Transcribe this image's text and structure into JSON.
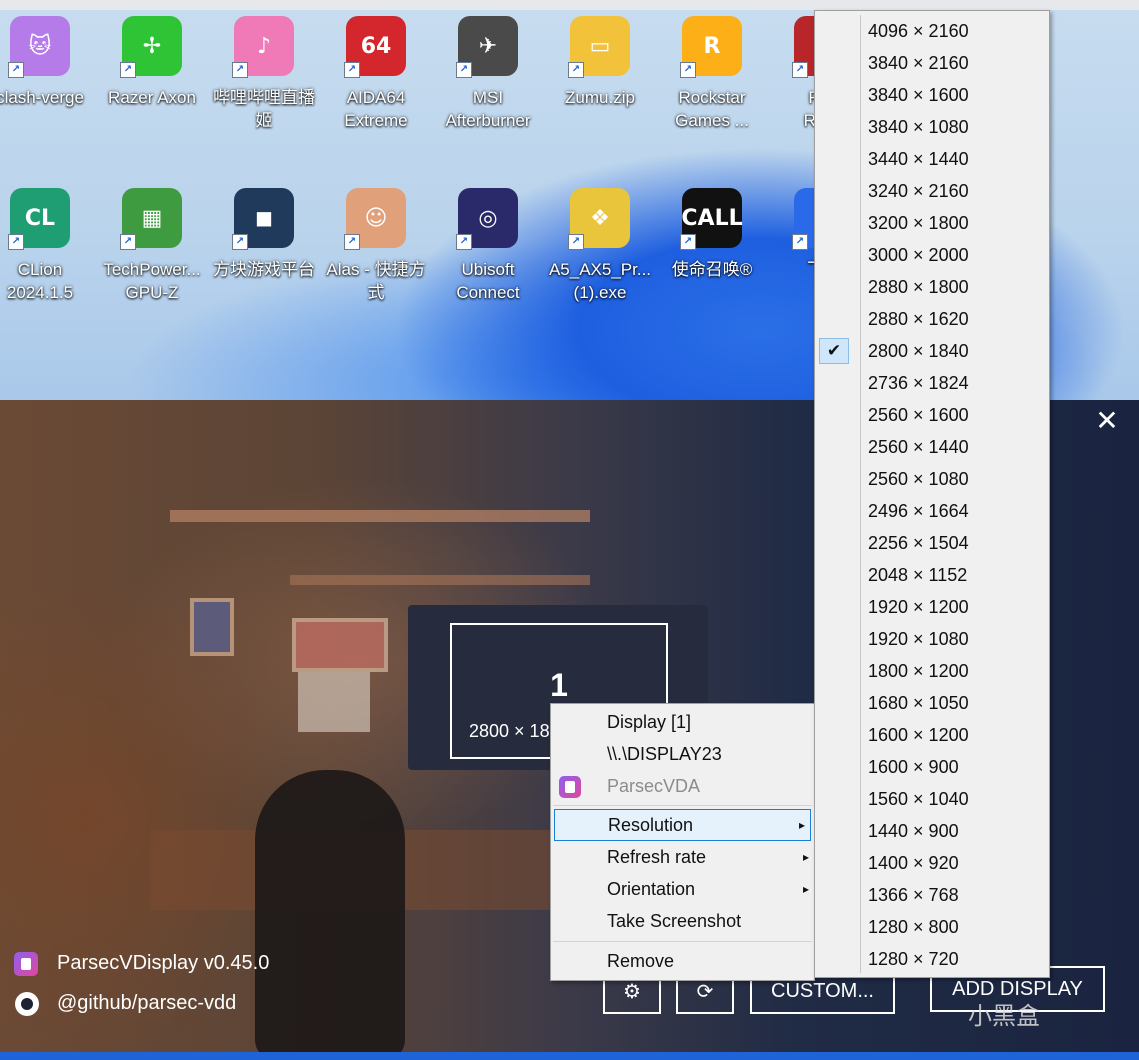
{
  "desktop": {
    "icons_row1": [
      {
        "label": "clash-verge",
        "glyph": "🐱",
        "color": "#b57be8"
      },
      {
        "label": "Razer Axon",
        "glyph": "✢",
        "color": "#2fc336"
      },
      {
        "label": "哔哩哔哩直播\n姬",
        "glyph": "♪",
        "color": "#f07ab8"
      },
      {
        "label": "AIDA64\nExtreme",
        "glyph": "64",
        "color": "#d3262d"
      },
      {
        "label": "MSI\nAfterburner",
        "glyph": "✈",
        "color": "#4a4a4a"
      },
      {
        "label": "Zumu.zip",
        "glyph": "▭",
        "color": "#f2c23a"
      },
      {
        "label": "Rockstar\nGames ...",
        "glyph": "R",
        "color": "#fcaf17"
      },
      {
        "label": "Red\nRede",
        "glyph": "◆",
        "color": "#b8262a"
      }
    ],
    "icons_row2": [
      {
        "label": "CLion\n2024.1.5",
        "glyph": "CL",
        "color": "#1f9e73"
      },
      {
        "label": "TechPower...\nGPU-Z",
        "glyph": "▦",
        "color": "#3f9b3f"
      },
      {
        "label": "方块游戏平台",
        "glyph": "◼",
        "color": "#1f3a5a"
      },
      {
        "label": "Alas - 快捷方\n式",
        "glyph": "☺",
        "color": "#e0a07a"
      },
      {
        "label": "Ubisoft\nConnect",
        "glyph": "◎",
        "color": "#2a2a6a"
      },
      {
        "label": "A5_AX5_Pr...\n(1).exe",
        "glyph": "❖",
        "color": "#e8c53a"
      },
      {
        "label": "使命召唤®",
        "glyph": "CALL",
        "color": "#111111"
      },
      {
        "label": "飞智",
        "glyph": "◣",
        "color": "#2a6ae8"
      }
    ]
  },
  "parsec": {
    "app_name": "ParsecVDisplay v0.45.0",
    "github": "@github/parsec-vdd",
    "display_number": "1",
    "display_resolution": "2800 × 18",
    "close_glyph": "✕",
    "buttons": {
      "settings_glyph": "⚙",
      "refresh_glyph": "⟳",
      "custom": "CUSTOM...",
      "add_display": "ADD DISPLAY"
    },
    "watermark": "小黑盒"
  },
  "context_menu": {
    "display": "Display [1]",
    "device": "\\\\.\\DISPLAY23",
    "adapter": "ParsecVDA",
    "resolution": "Resolution",
    "refresh_rate": "Refresh rate",
    "orientation": "Orientation",
    "take_screenshot": "Take Screenshot",
    "remove": "Remove",
    "submenu_arrow": "▸"
  },
  "resolution_menu": {
    "check_glyph": "✔",
    "selected": "2800 × 1840",
    "items": [
      "4096 × 2160",
      "3840 × 2160",
      "3840 × 1600",
      "3840 × 1080",
      "3440 × 1440",
      "3240 × 2160",
      "3200 × 1800",
      "3000 × 2000",
      "2880 × 1800",
      "2880 × 1620",
      "2800 × 1840",
      "2736 × 1824",
      "2560 × 1600",
      "2560 × 1440",
      "2560 × 1080",
      "2496 × 1664",
      "2256 × 1504",
      "2048 × 1152",
      "1920 × 1200",
      "1920 × 1080",
      "1800 × 1200",
      "1680 × 1050",
      "1600 × 1200",
      "1600 × 900",
      "1560 × 1040",
      "1440 × 900",
      "1400 × 920",
      "1366 × 768",
      "1280 × 800",
      "1280 × 720"
    ]
  }
}
